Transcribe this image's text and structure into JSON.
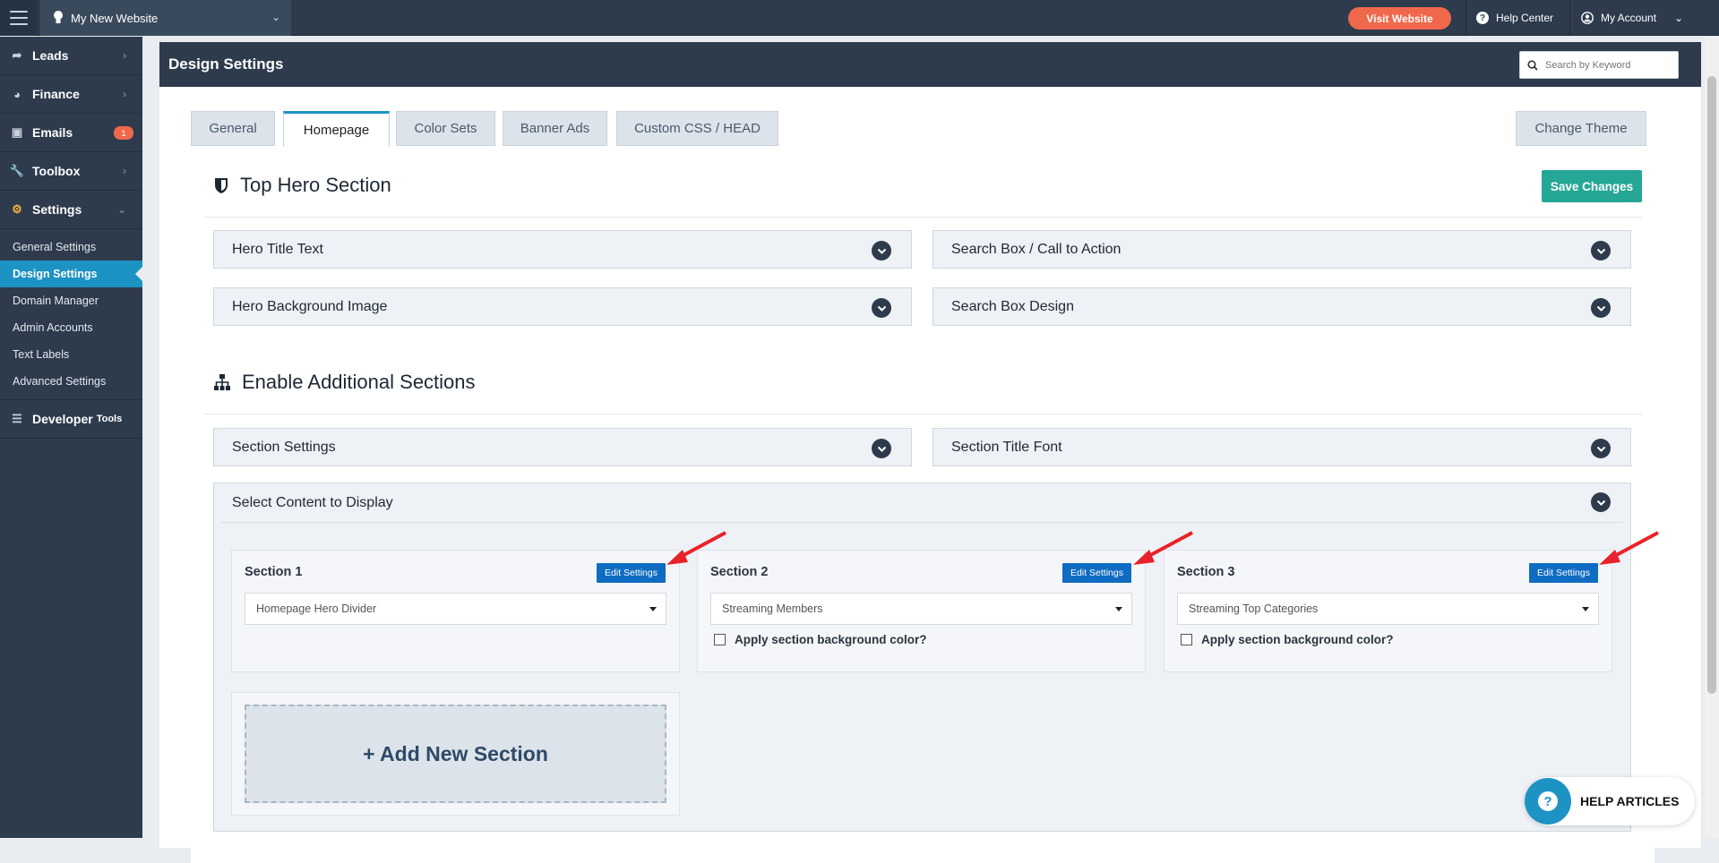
{
  "topbar": {
    "site_name": "My New Website",
    "visit_label": "Visit Website",
    "help_center_label": "Help Center",
    "my_account_label": "My Account"
  },
  "sidebar": {
    "items": [
      {
        "label": "Leads",
        "icon": "share-arrow-icon"
      },
      {
        "label": "Finance",
        "icon": "pie-chart-icon"
      },
      {
        "label": "Emails",
        "icon": "inbox-icon",
        "badge": "1"
      },
      {
        "label": "Toolbox",
        "icon": "wrench-icon"
      },
      {
        "label": "Settings",
        "icon": "gear-icon"
      }
    ],
    "sub_items": [
      "General Settings",
      "Design Settings",
      "Domain Manager",
      "Admin Accounts",
      "Text Labels",
      "Advanced Settings"
    ],
    "developer_label": "Developer",
    "developer_suffix": "Tools"
  },
  "panel": {
    "title": "Design Settings",
    "search_placeholder": "Search by Keyword"
  },
  "tabs": [
    "General",
    "Homepage",
    "Color Sets",
    "Banner Ads",
    "Custom CSS / HEAD"
  ],
  "change_theme_label": "Change Theme",
  "hero": {
    "title": "Top Hero Section",
    "save_label": "Save Changes",
    "accordions": [
      "Hero Title Text",
      "Search Box / Call to Action",
      "Hero Background Image",
      "Search Box Design"
    ]
  },
  "additional": {
    "title": "Enable Additional Sections",
    "accordions": [
      "Section Settings",
      "Section Title Font"
    ],
    "select_content_label": "Select Content to Display",
    "sections": [
      {
        "label": "Section 1",
        "edit_label": "Edit Settings",
        "value": "Homepage Hero Divider",
        "has_bg_option": false
      },
      {
        "label": "Section 2",
        "edit_label": "Edit Settings",
        "value": "Streaming Members",
        "has_bg_option": true
      },
      {
        "label": "Section 3",
        "edit_label": "Edit Settings",
        "value": "Streaming Top Categories",
        "has_bg_option": true
      }
    ],
    "bg_option_label": "Apply section background color?",
    "add_section_label": "+ Add New Section"
  },
  "help_articles_label": "HELP ARTICLES",
  "colors": {
    "dark": "#2d3b4d",
    "accent": "#1d93c4",
    "visit": "#f0684b",
    "save": "#25a796",
    "edit": "#0f6cc2",
    "arrow": "#e8222a"
  }
}
